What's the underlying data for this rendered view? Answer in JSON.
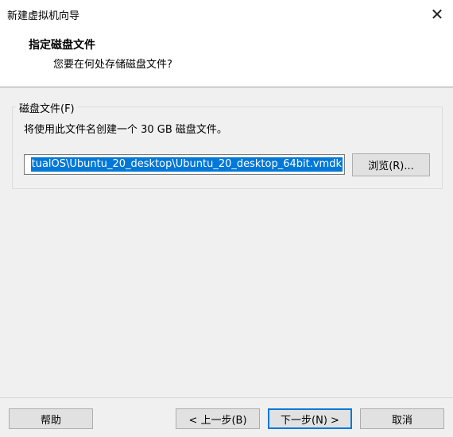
{
  "window": {
    "title": "新建虚拟机向导",
    "close_glyph": "✕"
  },
  "header": {
    "heading": "指定磁盘文件",
    "subheading": "您要在何处存储磁盘文件?"
  },
  "disk_file_group": {
    "label": "磁盘文件(F)",
    "description": "将使用此文件名创建一个 30 GB 磁盘文件。",
    "path_value": "tualOS\\Ubuntu_20_desktop\\Ubuntu_20_desktop_64bit.vmdk",
    "browse_label": "浏览(R)..."
  },
  "footer": {
    "help_label": "帮助",
    "back_label": "< 上一步(B)",
    "next_label": "下一步(N) >",
    "cancel_label": "取消"
  },
  "colors": {
    "selection": "#0078d7",
    "dialog_bg": "#f0f0f0",
    "header_bg": "#ffffff"
  },
  "icons": {
    "close": "close-icon"
  }
}
